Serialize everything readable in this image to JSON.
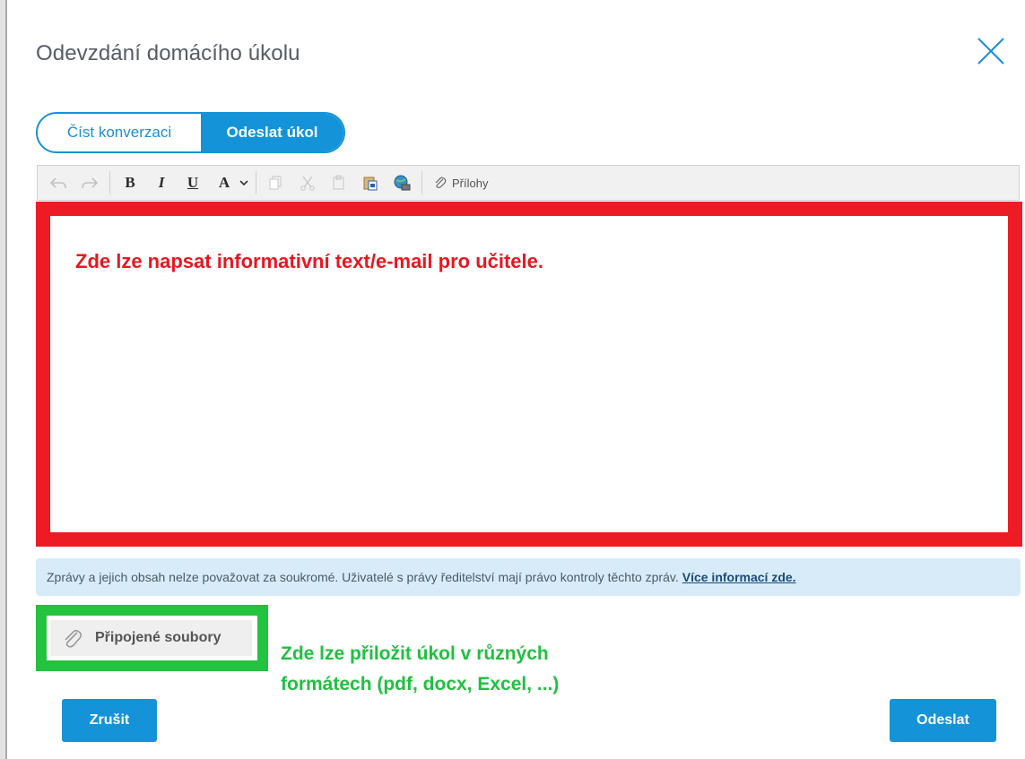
{
  "dialog": {
    "title": "Odevzdání domácího úkolu"
  },
  "tabs": [
    {
      "label": "Číst konverzaci",
      "active": false
    },
    {
      "label": "Odeslat úkol",
      "active": true
    }
  ],
  "toolbar": {
    "bold": "B",
    "italic": "I",
    "underline": "U",
    "font_color": "A",
    "attachments_label": "Přílohy"
  },
  "editor": {
    "annotation": "Zde lze napsat informativní text/e-mail pro učitele."
  },
  "info_bar": {
    "text": "Zprávy a jejich obsah nelze považovat za soukromé. Uživatelé s právy ředitelství mají právo kontroly těchto zpráv.",
    "link": "Více informací zde."
  },
  "attachments": {
    "label": "Připojené soubory",
    "annotation_line1": "Zde lze přiložit úkol v různých",
    "annotation_line2": "formátech (pdf, docx, Excel, ...)"
  },
  "buttons": {
    "cancel": "Zrušit",
    "send": "Odeslat"
  },
  "colors": {
    "accent": "#1493d8",
    "highlight_red": "#ed1c24",
    "highlight_green": "#22c33e",
    "info_bg": "#d7ecf8"
  }
}
